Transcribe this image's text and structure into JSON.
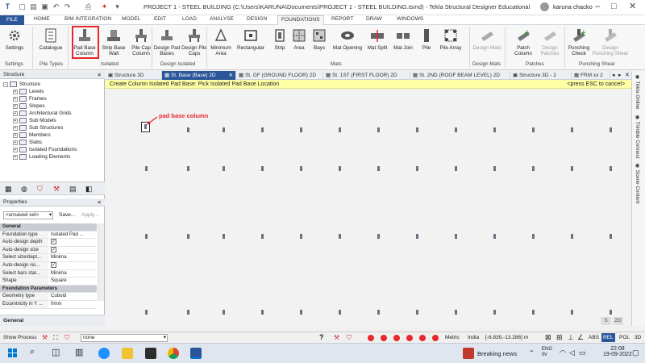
{
  "titlebar": {
    "title": "PROJECT 1 - STEEL BUILDING (C:\\Users\\KARUNA\\Documents\\PROJECT 1 - STEEL BUILDING.tsmd) - Tekla Structural Designer Educational",
    "user": "karuna chacko"
  },
  "menu": {
    "file": "FILE",
    "items": [
      "HOME",
      "BIM INTEGRATION",
      "MODEL",
      "EDIT",
      "LOAD",
      "ANALYSE",
      "DESIGN",
      "FOUNDATIONS",
      "REPORT",
      "DRAW",
      "WINDOWS"
    ]
  },
  "ribbon": {
    "buttons": {
      "settings": "Settings",
      "catalogue": "Catalogue",
      "pad_base_column": "Pad Base Column",
      "strip_base_wall": "Strip Base Wall",
      "pile_cap_column": "Pile Cap Column",
      "design_pad_bases": "Design Pad Bases",
      "design_pile_caps": "Design Pile Caps",
      "minimum_area": "Minimum Area",
      "rectangular": "Rectangular",
      "strip": "Strip",
      "area": "Area",
      "bays": "Bays",
      "mat_opening": "Mat Opening",
      "mat_split": "Mat Split",
      "mat_join": "Mat Join",
      "pile": "Pile",
      "pile_array": "Pile Array",
      "design_mats": "Design Mats",
      "patch_column": "Patch Column",
      "design_patches": "Design Patches",
      "punching_check": "Punching Check",
      "design_punching_shear": "Design Punching Shear"
    },
    "groups": {
      "settings": "Settings",
      "pile_types": "Pile Types",
      "isolated": "Isolated",
      "design_isolated": "Design Isolated",
      "mats": "Mats",
      "design_mats": "Design Mats",
      "patches": "Patches",
      "punching_shear": "Punching Shear"
    }
  },
  "structure": {
    "header": "Structure",
    "root": "Structure",
    "items": [
      "Levels",
      "Frames",
      "Slopes",
      "Architectural Grids",
      "Sub Models",
      "Sub Structures",
      "Members",
      "Slabs",
      "Isolated Foundations",
      "Loading Elements"
    ]
  },
  "properties": {
    "header": "Properties",
    "set_select": "<unsaved set>",
    "save": "Save...",
    "apply": "Apply...",
    "general": "General",
    "rows": [
      {
        "k": "Foundation type",
        "v": "Isolated Pad ..."
      },
      {
        "k": "Auto-design depth",
        "v": "check"
      },
      {
        "k": "Auto-design size",
        "v": "check"
      },
      {
        "k": "Select size/dept...",
        "v": "Minima"
      },
      {
        "k": "Auto-design rei...",
        "v": "check"
      },
      {
        "k": "Select bars star...",
        "v": "Minima"
      },
      {
        "k": "Shape",
        "v": "Square"
      }
    ],
    "foundation_params": "Foundation Parameters",
    "rows2": [
      {
        "k": "Geometry type",
        "v": "Cuboid"
      },
      {
        "k": "Eccentricity in Y ...",
        "v": "0mm"
      }
    ],
    "footer": "General"
  },
  "tabs": [
    "Structure 3D",
    "St. Base (Base) 2D",
    "St. GF (GROUND FLOOR) 2D",
    "St. 1ST (FIRST FLOOR) 2D",
    "St. 2ND (ROOF BEAM LEVEL) 2D",
    "Structure 3D - 2",
    "FRM xx 2"
  ],
  "command": {
    "text": "Create Column Isolated Pad Base: Pick Isolated Pad Base Location",
    "esc": "<press ESC to cancel>"
  },
  "annotation": {
    "label": "pad base column",
    "color": "#e8262b"
  },
  "view_buttons": [
    "S",
    "2D"
  ],
  "side": [
    "Tekla Online",
    "Trimble Connect",
    "Scene Content"
  ],
  "status": {
    "show_process": "Show Process",
    "filter": "none",
    "units": "Metric",
    "region": "India",
    "coords": "[-6.839,-13.286] m",
    "toggles": [
      "ABS",
      "REL",
      "POL",
      "3D"
    ]
  },
  "taskbar": {
    "weather": "Breaking news",
    "lang": "ENG\nIN",
    "time": "22:08",
    "date": "19-09-2022"
  },
  "colors": {
    "accent": "#2b579a",
    "highlight": "#e8262b",
    "command_bg": "#ffffa6"
  }
}
